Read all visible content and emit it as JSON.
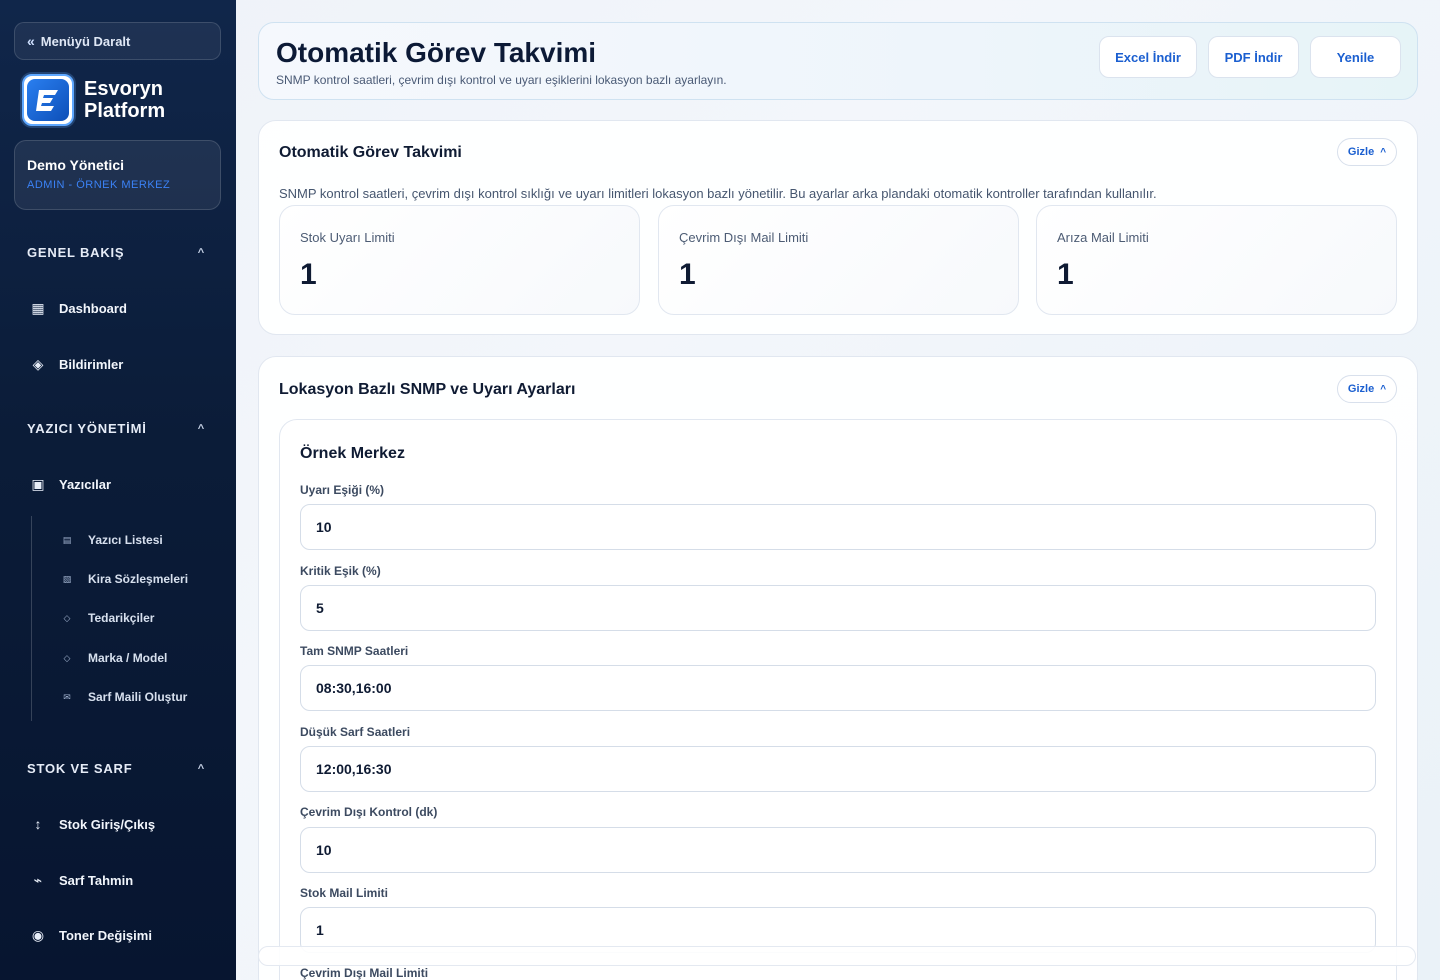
{
  "sidebar": {
    "collapse_label": "Menüyü Daralt",
    "brand_line1": "Esvoryn",
    "brand_line2": "Platform",
    "user_name": "Demo Yönetici",
    "user_role": "ADMIN - ÖRNEK MERKEZ",
    "sections": {
      "overview": "GENEL BAKIŞ",
      "printer_mgmt": "YAZICI YÖNETİMİ",
      "stock": "STOK VE SARF"
    },
    "items": {
      "dashboard": "Dashboard",
      "notifications": "Bildirimler",
      "printers": "Yazıcılar",
      "stock_io": "Stok Giriş/Çıkış",
      "forecast": "Sarf Tahmin",
      "toner": "Toner Değişimi"
    },
    "sub_items": {
      "printer_list": "Yazıcı Listesi",
      "leases": "Kira Sözleşmeleri",
      "suppliers": "Tedarikçiler",
      "brand_model": "Marka / Model",
      "supply_mail": "Sarf Maili Oluştur"
    }
  },
  "header": {
    "title": "Otomatik Görev Takvimi",
    "subtitle": "SNMP kontrol saatleri, çevrim dışı kontrol ve uyarı eşiklerini lokasyon bazlı ayarlayın.",
    "buttons": {
      "excel": "Excel İndir",
      "pdf": "PDF İndir",
      "refresh": "Yenile"
    }
  },
  "schedule_card": {
    "title": "Otomatik Görev Takvimi",
    "hide_label": "Gizle",
    "description": "SNMP kontrol saatleri, çevrim dışı kontrol sıklığı ve uyarı limitleri lokasyon bazlı yönetilir. Bu ayarlar arka plandaki otomatik kontroller tarafından kullanılır.",
    "stats": [
      {
        "label": "Stok Uyarı Limiti",
        "value": "1"
      },
      {
        "label": "Çevrim Dışı Mail Limiti",
        "value": "1"
      },
      {
        "label": "Arıza Mail Limiti",
        "value": "1"
      }
    ]
  },
  "location_card": {
    "title": "Lokasyon Bazlı SNMP ve Uyarı Ayarları",
    "hide_label": "Gizle",
    "location_name": "Örnek Merkez",
    "fields": [
      {
        "label": "Uyarı Eşiği (%)",
        "value": "10"
      },
      {
        "label": "Kritik Eşik (%)",
        "value": "5"
      },
      {
        "label": "Tam SNMP Saatleri",
        "value": "08:30,16:00"
      },
      {
        "label": "Düşük Sarf Saatleri",
        "value": "12:00,16:30"
      },
      {
        "label": "Çevrim Dışı Kontrol (dk)",
        "value": "10"
      },
      {
        "label": "Stok Mail Limiti",
        "value": "1"
      },
      {
        "label": "Çevrim Dışı Mail Limiti",
        "value": ""
      }
    ]
  }
}
